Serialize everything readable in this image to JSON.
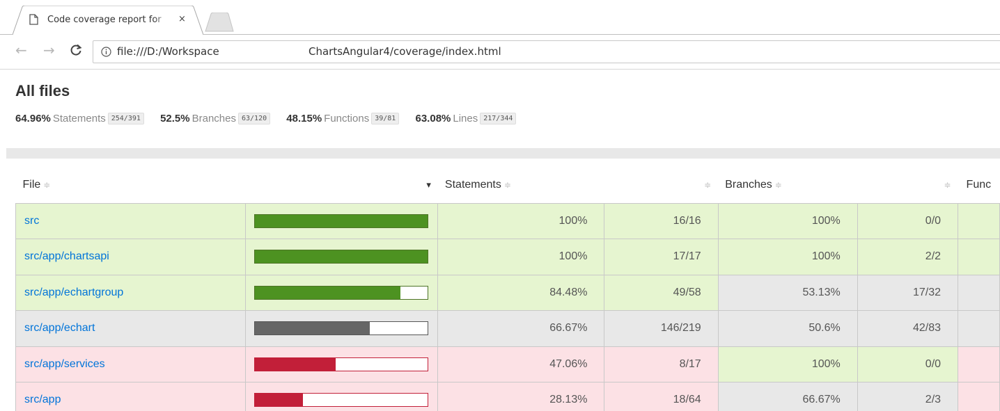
{
  "browser": {
    "tab_title": "Code coverage report for",
    "close_glyph": "×",
    "url_visible_start": "file:///D:/Workspace",
    "url_visible_end": "ChartsAngular4/coverage/index.html"
  },
  "report": {
    "title": "All files",
    "summary": [
      {
        "pct": "64.96%",
        "label": "Statements",
        "fraction": "254/391"
      },
      {
        "pct": "52.5%",
        "label": "Branches",
        "fraction": "63/120"
      },
      {
        "pct": "48.15%",
        "label": "Functions",
        "fraction": "39/81"
      },
      {
        "pct": "63.08%",
        "label": "Lines",
        "fraction": "217/344"
      }
    ],
    "table": {
      "headers": {
        "file": "File",
        "statements": "Statements",
        "branches": "Branches",
        "functions": "Func"
      },
      "sort_glyph": "≑",
      "sort_active_glyph": "▾",
      "rows": [
        {
          "file": "src",
          "level": "high",
          "bar_pct": 100,
          "stmt_pct": "100%",
          "stmt_frac": "16/16",
          "branch_pct": "100%",
          "branch_frac": "0/0",
          "branch_level": "high",
          "func_level": "high"
        },
        {
          "file": "src/app/chartsapi",
          "level": "high",
          "bar_pct": 100,
          "stmt_pct": "100%",
          "stmt_frac": "17/17",
          "branch_pct": "100%",
          "branch_frac": "2/2",
          "branch_level": "high",
          "func_level": "high"
        },
        {
          "file": "src/app/echartgroup",
          "level": "high",
          "bar_pct": 84.48,
          "stmt_pct": "84.48%",
          "stmt_frac": "49/58",
          "branch_pct": "53.13%",
          "branch_frac": "17/32",
          "branch_level": "medium",
          "func_level": "medium"
        },
        {
          "file": "src/app/echart",
          "level": "medium",
          "bar_pct": 66.67,
          "stmt_pct": "66.67%",
          "stmt_frac": "146/219",
          "branch_pct": "50.6%",
          "branch_frac": "42/83",
          "branch_level": "medium",
          "func_level": "medium"
        },
        {
          "file": "src/app/services",
          "level": "low",
          "bar_pct": 47.06,
          "stmt_pct": "47.06%",
          "stmt_frac": "8/17",
          "branch_pct": "100%",
          "branch_frac": "0/0",
          "branch_level": "high",
          "func_level": "low"
        },
        {
          "file": "src/app",
          "level": "low",
          "bar_pct": 28.13,
          "stmt_pct": "28.13%",
          "stmt_frac": "18/64",
          "branch_pct": "66.67%",
          "branch_frac": "2/3",
          "branch_level": "medium",
          "func_level": "low"
        }
      ]
    }
  },
  "colors": {
    "high_bg": "#e6f5d0",
    "medium_bg": "#e8e8e8",
    "low_bg": "#fce1e5",
    "high_bar": "#4d9221",
    "medium_bar": "#666666",
    "low_bar": "#c21f39",
    "link": "#0074d9"
  }
}
